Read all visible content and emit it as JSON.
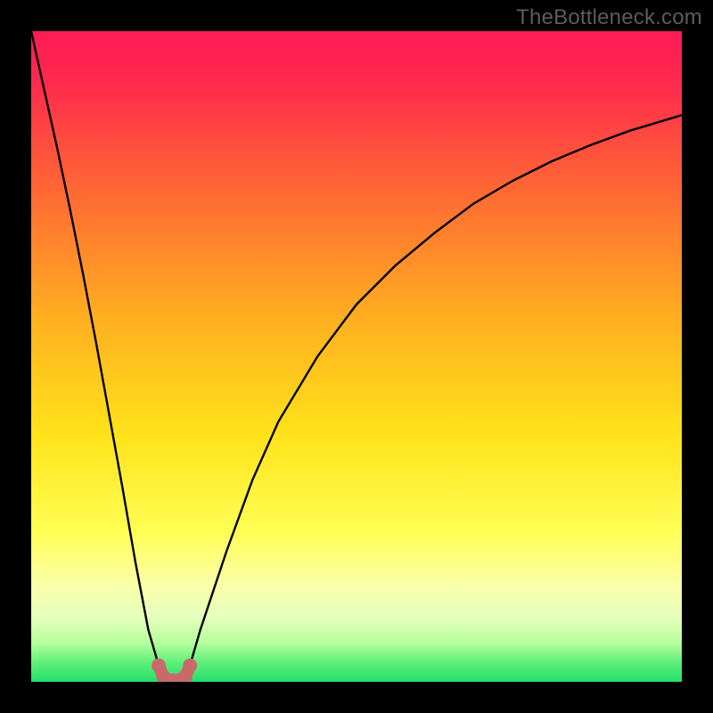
{
  "watermark": "TheBottleneck.com",
  "colors": {
    "top": "#ff1b55",
    "mid_upper": "#ff7c2f",
    "mid": "#ffd61a",
    "mid_lower": "#ffff6b",
    "pale_band": "#f7ffb8",
    "bottom": "#22e06b",
    "curve": "#000000",
    "marker": "#c96a6a",
    "frame": "#000000"
  },
  "chart_data": {
    "type": "line",
    "title": "",
    "xlabel": "",
    "ylabel": "",
    "x_range": [
      0,
      100
    ],
    "y_range": [
      0,
      100
    ],
    "annotations": [],
    "legend": [],
    "left_curve": {
      "x": [
        0,
        2,
        4,
        6,
        8,
        10,
        12,
        14,
        16,
        18,
        19.6,
        20.3
      ],
      "y": [
        100,
        91,
        82,
        72.5,
        62.5,
        52,
        41,
        30,
        18.5,
        8,
        2.5,
        0.8
      ]
    },
    "right_curve": {
      "x": [
        23.7,
        24.4,
        26,
        28,
        30,
        34,
        38,
        44,
        50,
        56,
        62,
        68,
        74,
        80,
        86,
        92,
        98,
        100
      ],
      "y": [
        0.8,
        2.5,
        8,
        14,
        20,
        31,
        40,
        50,
        58,
        64,
        69,
        73.5,
        77,
        80,
        82.5,
        84.7,
        86.5,
        87.1
      ]
    },
    "valley_markers": {
      "x": [
        19.6,
        20.3,
        21,
        22,
        23,
        23.7,
        24.4
      ],
      "y": [
        2.5,
        0.8,
        0.3,
        0.2,
        0.3,
        0.8,
        2.5
      ]
    },
    "valley_minimum_x": 22,
    "gradient_stops_pct": [
      {
        "offset": 0,
        "color": "#ff1b55"
      },
      {
        "offset": 8,
        "color": "#ff2a4d"
      },
      {
        "offset": 25,
        "color": "#ff6a33"
      },
      {
        "offset": 45,
        "color": "#ffb21f"
      },
      {
        "offset": 62,
        "color": "#ffe21a"
      },
      {
        "offset": 77,
        "color": "#ffff55"
      },
      {
        "offset": 85,
        "color": "#faffa7"
      },
      {
        "offset": 90,
        "color": "#e6ffbd"
      },
      {
        "offset": 94,
        "color": "#b6ff9d"
      },
      {
        "offset": 97,
        "color": "#60ef7a"
      },
      {
        "offset": 100,
        "color": "#22e06b"
      }
    ]
  }
}
